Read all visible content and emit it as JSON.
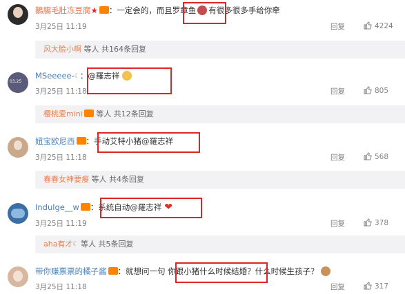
{
  "comments": [
    {
      "user": "鵝腸毛肚冻豆腐",
      "badge": "V",
      "sep": "：",
      "text": "一定会的，而且罗章鱼",
      "text2": "有很多很多手给你牵",
      "date": "3月25日 11:19",
      "reply": "回复",
      "likes": "4224",
      "sub": {
        "user": "风大脸小啊",
        "rest": " 等人 共164条回复"
      }
    },
    {
      "user": "MSeeeee-",
      "badge": "V",
      "sep": "：",
      "text": "@羅志祥",
      "date": "3月25日 11:18",
      "reply": "回复",
      "likes": "805",
      "sub": {
        "user": "樱桃爱mini",
        "rest": " 等人 共12条回复"
      }
    },
    {
      "user": "妞宝欧尼西",
      "badge": "V",
      "sep": "：",
      "text": "手动艾特小猪@羅志祥",
      "date": "3月25日 11:18",
      "reply": "回复",
      "likes": "568",
      "sub": {
        "user": "春春女神要瘦",
        "rest": " 等人 共4条回复"
      }
    },
    {
      "user": "Indulge__w",
      "badge": "V",
      "sep": "：",
      "text": "系统自动@羅志祥",
      "date": "3月25日 11:19",
      "reply": "回复",
      "likes": "378",
      "sub": {
        "user": "aha有才",
        "rest": " 等人 共5条回复"
      }
    },
    {
      "user": "带你赚票票的橘子酱",
      "badge": "V",
      "sep": "：",
      "text": "就想问一句 你跟小猪什么时候结婚？",
      "text2": "什么时候生孩子？",
      "date": "3月25日 11:18",
      "reply": "回复",
      "likes": "317"
    }
  ]
}
